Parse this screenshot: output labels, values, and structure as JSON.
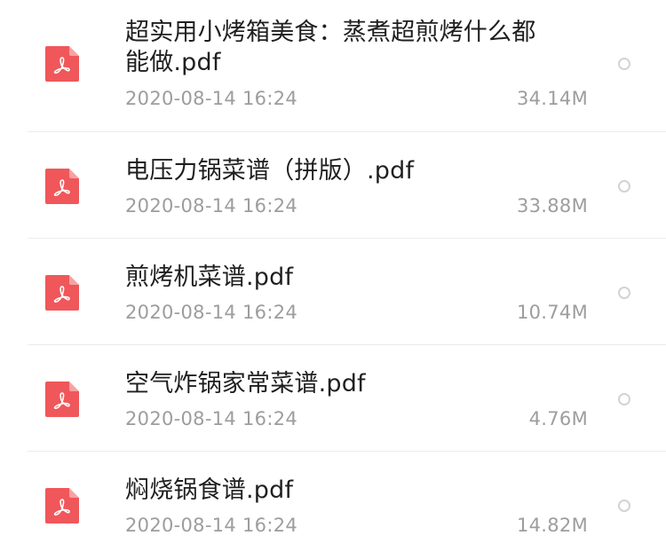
{
  "files": [
    {
      "name": "超实用小烤箱美食：蒸煮超煎烤什么都能做.pdf",
      "date": "2020-08-14 16:24",
      "size": "34.14M",
      "icon": "pdf-file-icon"
    },
    {
      "name": "电压力锅菜谱（拼版）.pdf",
      "date": "2020-08-14 16:24",
      "size": "33.88M",
      "icon": "pdf-file-icon"
    },
    {
      "name": "煎烤机菜谱.pdf",
      "date": "2020-08-14 16:24",
      "size": "10.74M",
      "icon": "pdf-file-icon"
    },
    {
      "name": "空气炸锅家常菜谱.pdf",
      "date": "2020-08-14 16:24",
      "size": "4.76M",
      "icon": "pdf-file-icon"
    },
    {
      "name": "焖烧锅食谱.pdf",
      "date": "2020-08-14 16:24",
      "size": "14.82M",
      "icon": "pdf-file-icon"
    }
  ],
  "colors": {
    "pdf_icon": "#f0575a",
    "text_primary": "#1f1f1f",
    "text_secondary": "#9d9d9d",
    "divider": "#ececec"
  }
}
